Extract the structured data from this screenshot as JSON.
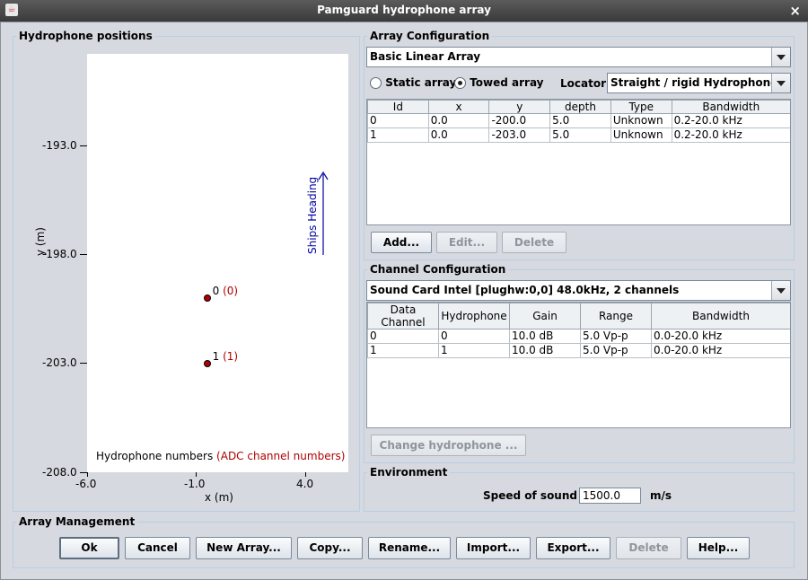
{
  "window": {
    "title": "Pamguard hydrophone array",
    "close_label": "×",
    "app_icon": "java-icon"
  },
  "positions": {
    "group_label": "Hydrophone positions",
    "y_ticks": [
      "-193.0",
      "-198.0",
      "-203.0",
      "-208.0"
    ],
    "x_ticks": [
      "-6.0",
      "-1.0",
      "4.0"
    ],
    "y_axis_label": "y (m)",
    "x_axis_label": "x (m)",
    "heading_label": "Ships Heading",
    "legend_prefix": "Hydrophone numbers",
    "legend_suffix": "(ADC channel numbers)",
    "accent_color": "#b00000",
    "arrow_color": "#0000a0",
    "points": [
      {
        "x": -0.5,
        "y": -200.0,
        "label": "0",
        "channel": "(0)"
      },
      {
        "x": -0.5,
        "y": -203.0,
        "label": "1",
        "channel": "(1)"
      }
    ]
  },
  "array_config": {
    "group_label": "Array Configuration",
    "array_select": "Basic Linear Array",
    "static_label": "Static array",
    "towed_label": "Towed array",
    "selected_type": "towed",
    "locator_label": "Locator:",
    "locator_select": "Straight / rigid Hydrophone",
    "columns": [
      "Id",
      "x",
      "y",
      "depth",
      "Type",
      "Bandwidth"
    ],
    "rows": [
      [
        "0",
        "0.0",
        "-200.0",
        "5.0",
        "Unknown",
        "0.2-20.0 kHz"
      ],
      [
        "1",
        "0.0",
        "-203.0",
        "5.0",
        "Unknown",
        "0.2-20.0 kHz"
      ]
    ],
    "add_label": "Add...",
    "edit_label": "Edit...",
    "delete_label": "Delete"
  },
  "channel_config": {
    "group_label": "Channel Configuration",
    "source_select": "Sound Card Intel [plughw:0,0] 48.0kHz, 2 channels",
    "columns": [
      "Data Channel",
      "Hydrophone",
      "Gain",
      "Range",
      "Bandwidth"
    ],
    "rows": [
      [
        "0",
        "0",
        "10.0 dB",
        "5.0 Vp-p",
        "0.0-20.0 kHz"
      ],
      [
        "1",
        "1",
        "10.0 dB",
        "5.0 Vp-p",
        "0.0-20.0 kHz"
      ]
    ],
    "change_label": "Change hydrophone ..."
  },
  "environment": {
    "group_label": "Environment",
    "sound_label": "Speed of sound",
    "sound_value": "1500.0",
    "sound_unit": "m/s"
  },
  "management": {
    "group_label": "Array Management",
    "buttons": {
      "ok": "Ok",
      "cancel": "Cancel",
      "new_array": "New Array...",
      "copy": "Copy...",
      "rename": "Rename...",
      "import": "Import...",
      "export": "Export...",
      "delete": "Delete",
      "help": "Help..."
    }
  }
}
